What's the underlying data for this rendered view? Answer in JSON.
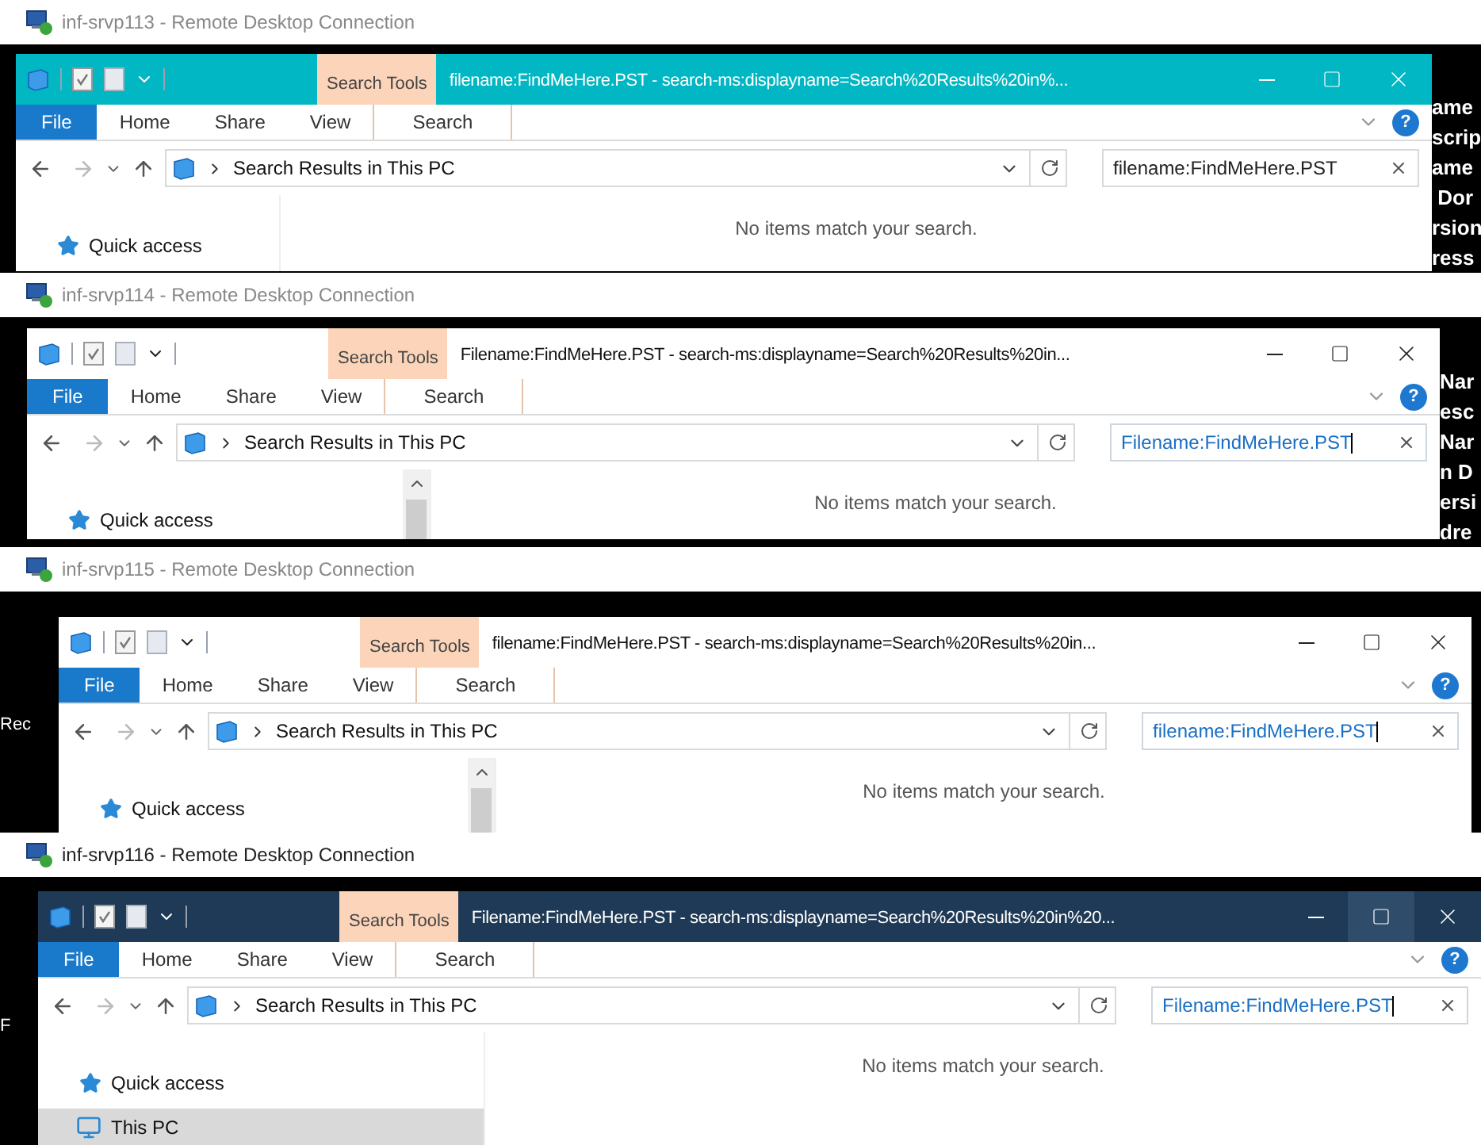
{
  "sessions": [
    {
      "title": "inf-srvp113 - Remote Desktop Connection",
      "background_text": [
        "ame",
        "scrip",
        "ame",
        " Dor",
        "rsion",
        "ress"
      ],
      "explorer": {
        "color": "#00b7c3",
        "help_label": "?",
        "maximize_hovered": false,
        "contextual_tab": "Search Tools",
        "title": "filename:FindMeHere.PST - search-ms:displayname=Search%20Results%20in%...",
        "tabs": [
          {
            "label": "File",
            "kind": "file"
          },
          {
            "label": "Home",
            "kind": "tab"
          },
          {
            "label": "Share",
            "kind": "tab"
          },
          {
            "label": "View",
            "kind": "tab"
          },
          {
            "label": "Search",
            "kind": "contextual"
          }
        ],
        "location": "Search Results in This PC",
        "search": {
          "value": "filename:FindMeHere.PST",
          "focused": false
        },
        "scrollbar": false,
        "nav_items": [
          {
            "label": "Quick access",
            "kind": "quick-access",
            "selected": false
          }
        ],
        "message": "No items match your search."
      }
    },
    {
      "title": "inf-srvp114 - Remote Desktop Connection",
      "background_text": [
        "Nar",
        "esc",
        "Nar",
        "n D",
        "ersi",
        "dre"
      ],
      "explorer": {
        "color": "#ffffff",
        "maximize_hovered": false,
        "contextual_tab": "Search Tools",
        "title": "Filename:FindMeHere.PST - search-ms:displayname=Search%20Results%20in...",
        "tabs": [
          {
            "label": "File",
            "kind": "file"
          },
          {
            "label": "Home",
            "kind": "tab"
          },
          {
            "label": "Share",
            "kind": "tab"
          },
          {
            "label": "View",
            "kind": "tab"
          },
          {
            "label": "Search",
            "kind": "contextual"
          }
        ],
        "location": "Search Results in This PC",
        "search": {
          "value": "Filename:FindMeHere.PST",
          "focused": true
        },
        "help_label": "?",
        "scrollbar": true,
        "nav_items": [
          {
            "label": "Quick access",
            "kind": "quick-access",
            "selected": false
          }
        ],
        "message": "No items match your search."
      }
    },
    {
      "title": "inf-srvp115 - Remote Desktop Connection",
      "desktop_labels": [
        "Rec"
      ],
      "explorer": {
        "color": "#ffffff",
        "maximize_hovered": false,
        "contextual_tab": "Search Tools",
        "title": "filename:FindMeHere.PST - search-ms:displayname=Search%20Results%20in...",
        "tabs": [
          {
            "label": "File",
            "kind": "file"
          },
          {
            "label": "Home",
            "kind": "tab"
          },
          {
            "label": "Share",
            "kind": "tab"
          },
          {
            "label": "View",
            "kind": "tab"
          },
          {
            "label": "Search",
            "kind": "contextual"
          }
        ],
        "location": "Search Results in This PC",
        "search": {
          "value": "filename:FindMeHere.PST",
          "focused": true
        },
        "help_label": "?",
        "scrollbar": true,
        "nav_items": [
          {
            "label": "Quick access",
            "kind": "quick-access",
            "selected": false
          }
        ],
        "message": "No items match your search."
      }
    },
    {
      "title": "inf-srvp116 - Remote Desktop Connection",
      "desktop_labels": [
        "F"
      ],
      "explorer": {
        "color": "#1f3a56",
        "help_label": "?",
        "maximize_hovered": true,
        "contextual_tab": "Search Tools",
        "title": "Filename:FindMeHere.PST - search-ms:displayname=Search%20Results%20in%20...",
        "tabs": [
          {
            "label": "File",
            "kind": "file"
          },
          {
            "label": "Home",
            "kind": "tab"
          },
          {
            "label": "Share",
            "kind": "tab"
          },
          {
            "label": "View",
            "kind": "tab"
          },
          {
            "label": "Search",
            "kind": "contextual"
          }
        ],
        "location": "Search Results in This PC",
        "search": {
          "value": "Filename:FindMeHere.PST",
          "focused": true
        },
        "scrollbar": false,
        "nav_items": [
          {
            "label": "Quick access",
            "kind": "quick-access",
            "selected": false
          },
          {
            "label": "This PC",
            "kind": "computer",
            "selected": true
          }
        ],
        "message": "No items match your search."
      }
    }
  ]
}
